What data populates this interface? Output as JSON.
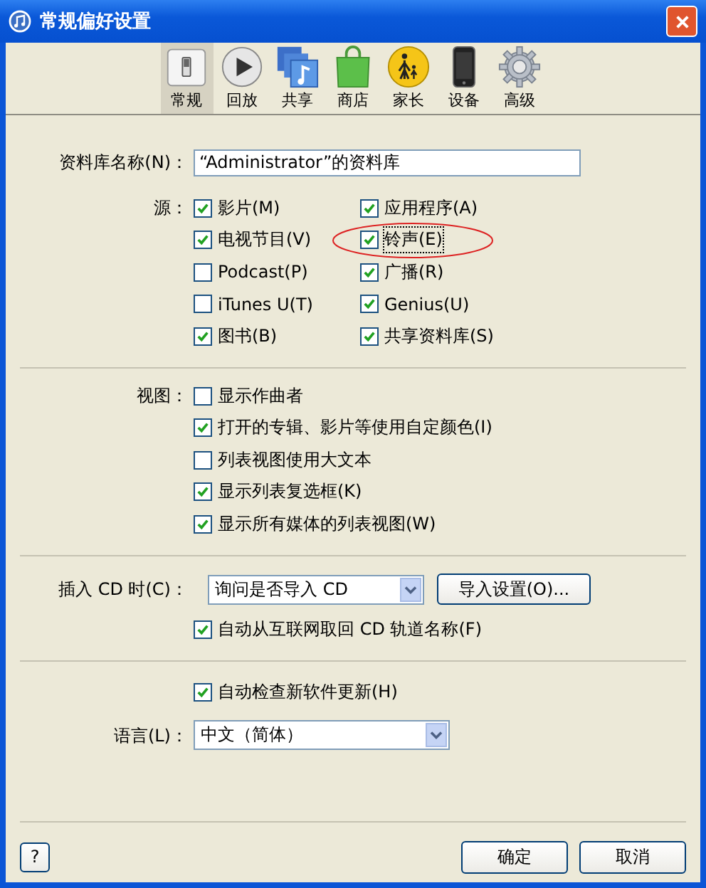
{
  "window": {
    "title": "常规偏好设置"
  },
  "tabs": [
    {
      "label": "常规",
      "kind": "general",
      "selected": true
    },
    {
      "label": "回放",
      "kind": "playback",
      "selected": false
    },
    {
      "label": "共享",
      "kind": "sharing",
      "selected": false
    },
    {
      "label": "商店",
      "kind": "store",
      "selected": false
    },
    {
      "label": "家长",
      "kind": "parental",
      "selected": false
    },
    {
      "label": "设备",
      "kind": "devices",
      "selected": false
    },
    {
      "label": "高级",
      "kind": "advanced",
      "selected": false
    }
  ],
  "library_name": {
    "label": "资料库名称(N)：",
    "value": "“Administrator”的资料库"
  },
  "sources": {
    "label": "源：",
    "items": [
      {
        "label": "影片(M)",
        "checked": true,
        "highlighted": false
      },
      {
        "label": "应用程序(A)",
        "checked": true,
        "highlighted": false
      },
      {
        "label": "电视节目(V)",
        "checked": true,
        "highlighted": false
      },
      {
        "label": "铃声(E)",
        "checked": true,
        "highlighted": true
      },
      {
        "label": "Podcast(P)",
        "checked": false,
        "highlighted": false
      },
      {
        "label": "广播(R)",
        "checked": true,
        "highlighted": false
      },
      {
        "label": "iTunes U(T)",
        "checked": false,
        "highlighted": false
      },
      {
        "label": "Genius(U)",
        "checked": true,
        "highlighted": false
      },
      {
        "label": "图书(B)",
        "checked": true,
        "highlighted": false
      },
      {
        "label": "共享资料库(S)",
        "checked": true,
        "highlighted": false
      }
    ]
  },
  "view": {
    "label": "视图：",
    "items": [
      {
        "label": "显示作曲者",
        "checked": false
      },
      {
        "label": "打开的专辑、影片等使用自定颜色(I)",
        "checked": true
      },
      {
        "label": "列表视图使用大文本",
        "checked": false
      },
      {
        "label": "显示列表复选框(K)",
        "checked": true
      },
      {
        "label": "显示所有媒体的列表视图(W)",
        "checked": true
      }
    ]
  },
  "cd": {
    "label": "插入 CD 时(C)：",
    "select": "询问是否导入 CD",
    "button": "导入设置(O)...",
    "auto": {
      "label": "自动从互联网取回 CD 轨道名称(F)",
      "checked": true
    }
  },
  "updates": {
    "label": "自动检查新软件更新(H)",
    "checked": true
  },
  "language": {
    "label": "语言(L)：",
    "value": "中文（简体）"
  },
  "help": "?",
  "buttons": [
    "确定",
    "取消"
  ]
}
